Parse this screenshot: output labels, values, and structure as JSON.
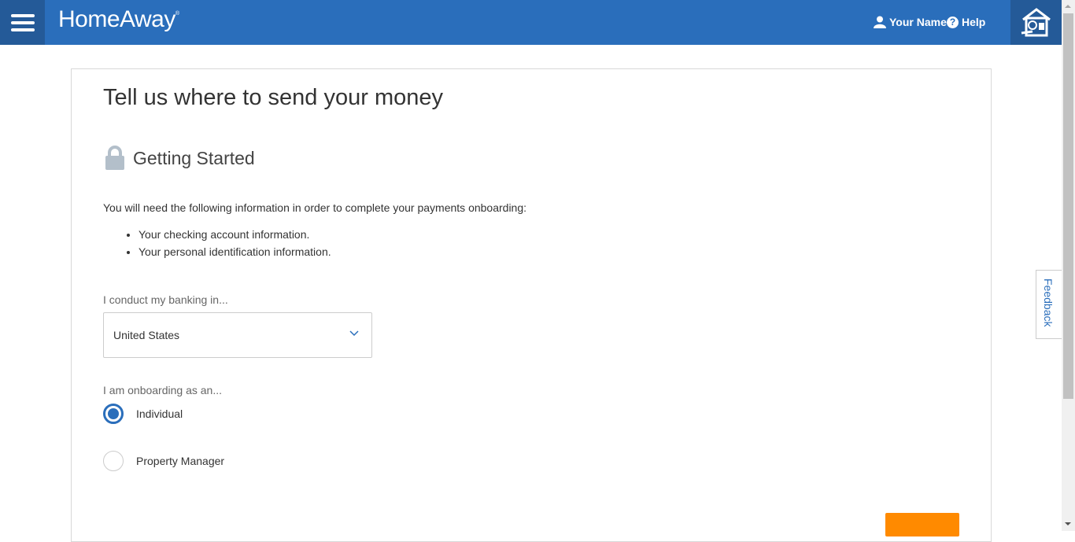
{
  "header": {
    "brand": "HomeAway",
    "brand_mark": "®",
    "user_label": "Your Name",
    "help_label": "Help",
    "icons": {
      "menu": "hamburger-icon",
      "user": "user-icon",
      "help": "question-circle-icon",
      "brand": "birdhouse-logo-icon"
    }
  },
  "page": {
    "title": "Tell us where to send your money",
    "section_title": "Getting Started",
    "section_icon": "lock-icon",
    "intro": "You will need the following information in order to complete your payments onboarding:",
    "requirements": [
      "Your checking account information.",
      "Your personal identification information."
    ],
    "banking_label": "I conduct my banking in...",
    "banking_value": "United States",
    "onboarding_label": "I am onboarding as an...",
    "onboarding_options": [
      {
        "label": "Individual",
        "selected": true
      },
      {
        "label": "Property Manager",
        "selected": false
      }
    ]
  },
  "feedback_label": "Feedback",
  "colors": {
    "brand_blue": "#2a6ebb",
    "brand_dark": "#245a98",
    "cta_orange": "#ff8a00"
  }
}
